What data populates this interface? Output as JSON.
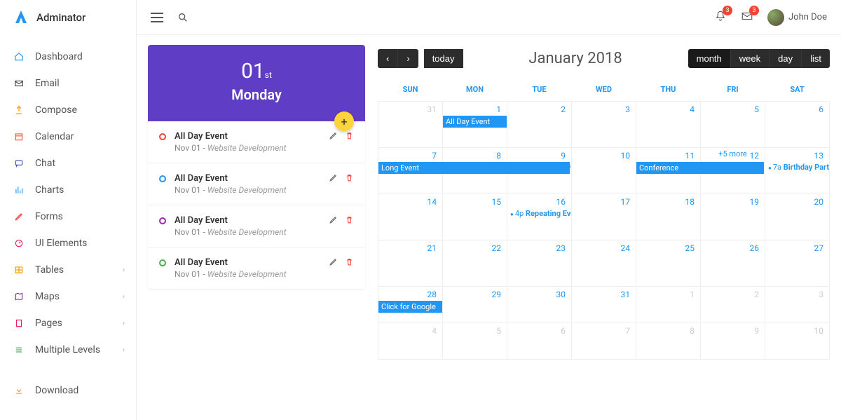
{
  "brand": "Adminator",
  "sidebar": {
    "items": [
      {
        "label": "Dashboard",
        "color": "#2196f3",
        "icon": "home"
      },
      {
        "label": "Email",
        "color": "#444",
        "icon": "mail"
      },
      {
        "label": "Compose",
        "color": "#ff9800",
        "icon": "share"
      },
      {
        "label": "Calendar",
        "color": "#ff5722",
        "icon": "cal"
      },
      {
        "label": "Chat",
        "color": "#3f51b5",
        "icon": "chat"
      },
      {
        "label": "Charts",
        "color": "#2196f3",
        "icon": "chart"
      },
      {
        "label": "Forms",
        "color": "#f44336",
        "icon": "pencil"
      },
      {
        "label": "UI Elements",
        "color": "#e91e63",
        "icon": "gauge"
      },
      {
        "label": "Tables",
        "color": "#ff9800",
        "icon": "table",
        "chev": true
      },
      {
        "label": "Maps",
        "color": "#9c27b0",
        "icon": "map",
        "chev": true
      },
      {
        "label": "Pages",
        "color": "#e91e63",
        "icon": "pages",
        "chev": true
      },
      {
        "label": "Multiple Levels",
        "color": "#4caf50",
        "icon": "levels",
        "chev": true
      }
    ],
    "download": "Download"
  },
  "topbar": {
    "notif_count": "3",
    "mail_count": "3",
    "user": "John Doe"
  },
  "day_card": {
    "num": "01",
    "suffix": "st",
    "weekday": "Monday",
    "events": [
      {
        "color": "#f44336",
        "title": "All Day Event",
        "date": "Nov 01",
        "project": "Website Development"
      },
      {
        "color": "#2196f3",
        "title": "All Day Event",
        "date": "Nov 01",
        "project": "Website Development"
      },
      {
        "color": "#9c27b0",
        "title": "All Day Event",
        "date": "Nov 01",
        "project": "Website Development"
      },
      {
        "color": "#4caf50",
        "title": "All Day Event",
        "date": "Nov 01",
        "project": "Website Development"
      }
    ]
  },
  "calendar": {
    "title": "January 2018",
    "today": "today",
    "views": {
      "month": "month",
      "week": "week",
      "day": "day",
      "list": "list"
    },
    "dow": [
      "SUN",
      "MON",
      "TUE",
      "WED",
      "THU",
      "FRI",
      "SAT"
    ],
    "events": {
      "all_day": "All Day Event",
      "long_event": "Long Event",
      "conference": "Conference",
      "birthday": "Birthday Party",
      "birthday_time": "7a",
      "repeating": "Repeating Event",
      "repeating_time": "4p",
      "more": "+5 more",
      "google": "Click for Google"
    }
  },
  "chart_data": null
}
